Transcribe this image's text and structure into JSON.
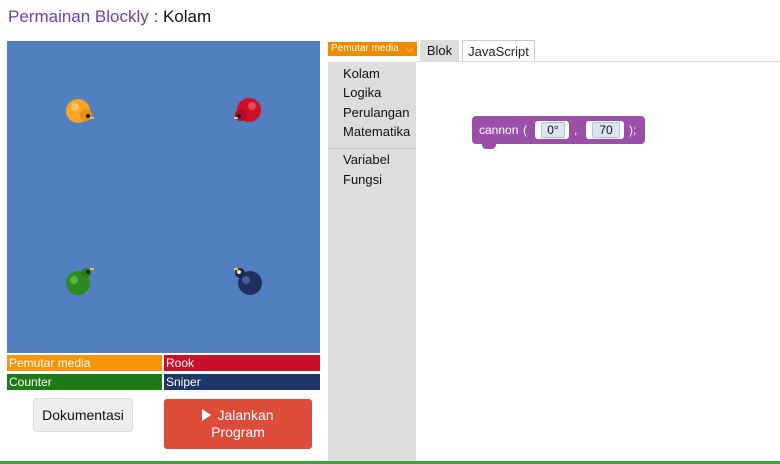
{
  "header": {
    "app_name": "Permainan Blockly",
    "separator": " : ",
    "game_name": "Kolam"
  },
  "pond": {
    "background_color": "#527fc0",
    "ducks": [
      {
        "name": "Pemutar media",
        "color": "#f5a623",
        "icon": "duck-orange"
      },
      {
        "name": "Rook",
        "color": "#d0112b",
        "icon": "duck-red"
      },
      {
        "name": "Counter",
        "color": "#2d8a1f",
        "icon": "duck-green"
      },
      {
        "name": "Sniper",
        "color": "#1f3060",
        "icon": "duck-navy"
      }
    ]
  },
  "legend": [
    {
      "label": "Pemutar media",
      "color": "#f6940a"
    },
    {
      "label": "Rook",
      "color": "#c8102e"
    },
    {
      "label": "Counter",
      "color": "#1e7a14"
    },
    {
      "label": "Sniper",
      "color": "#1f3566"
    }
  ],
  "buttons": {
    "docs": "Dokumentasi",
    "run_line1": "Jalankan",
    "run_line2": "Program"
  },
  "editor": {
    "player_select": "Pemutar media",
    "tabs": [
      "Blok",
      "JavaScript"
    ],
    "categories_main": [
      "Kolam",
      "Logika",
      "Perulangan",
      "Matematika"
    ],
    "categories_extra": [
      "Variabel",
      "Fungsi"
    ],
    "block": {
      "name": "cannon",
      "open_paren": "(",
      "comma": ",",
      "close_paren": ");",
      "angle": "0°",
      "range": "70"
    }
  },
  "colors": {
    "accent_purple": "#7a3aa8",
    "block_purple": "#9c4fa8",
    "run_button": "#dd4b39",
    "dropdown_orange": "#f08a00"
  }
}
